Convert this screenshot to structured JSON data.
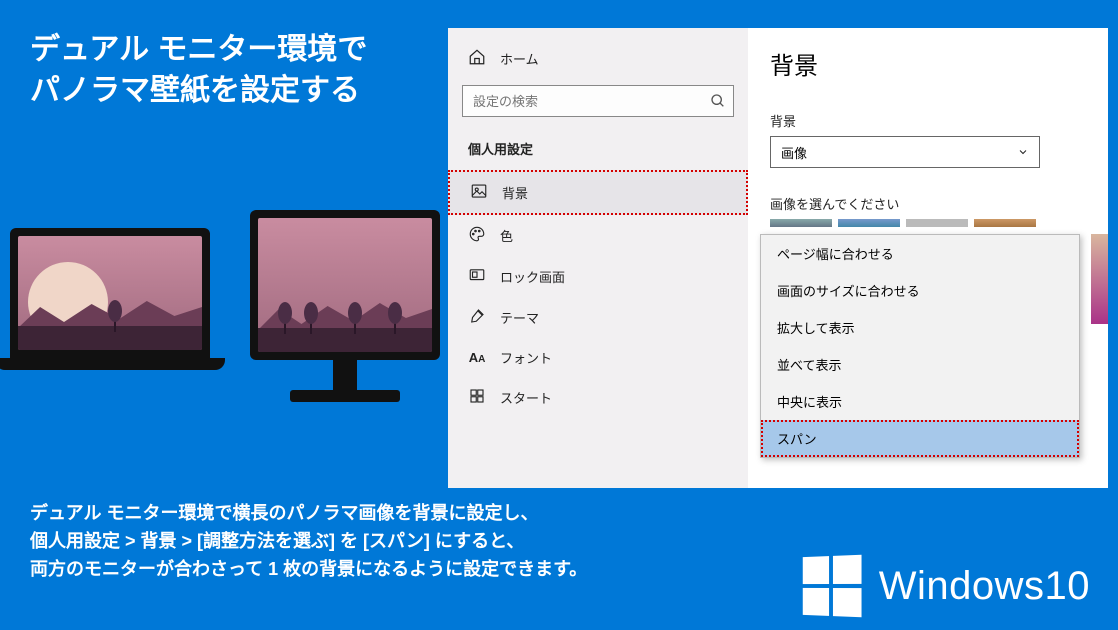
{
  "title": {
    "line1": "デュアル モニター環境で",
    "line2": "パノラマ壁紙を設定する"
  },
  "settings": {
    "home_label": "ホーム",
    "search_placeholder": "設定の検索",
    "section_title": "個人用設定",
    "nav": [
      {
        "icon": "picture",
        "label": "背景",
        "active": true,
        "highlight": true
      },
      {
        "icon": "palette",
        "label": "色",
        "active": false,
        "highlight": false
      },
      {
        "icon": "lock",
        "label": "ロック画面",
        "active": false,
        "highlight": false
      },
      {
        "icon": "brush",
        "label": "テーマ",
        "active": false,
        "highlight": false
      },
      {
        "icon": "font",
        "label": "フォント",
        "active": false,
        "highlight": false
      },
      {
        "icon": "start",
        "label": "スタート",
        "active": false,
        "highlight": false
      }
    ],
    "content": {
      "page_title": "背景",
      "bg_label": "背景",
      "bg_dropdown_value": "画像",
      "choose_label": "画像を選んでください"
    },
    "fit_menu": {
      "items": [
        "ページ幅に合わせる",
        "画面のサイズに合わせる",
        "拡大して表示",
        "並べて表示",
        "中央に表示",
        "スパン"
      ],
      "selected_index": 5,
      "highlight_index": 5
    }
  },
  "description": {
    "line1": "デュアル モニター環境で横長のパノラマ画像を背景に設定し、",
    "line2": "個人用設定 > 背景 > [調整方法を選ぶ] を [スパン] にすると、",
    "line3": "両方のモニターが合わさって 1 枚の背景になるように設定できます。"
  },
  "footer": {
    "product": "Windows10"
  }
}
